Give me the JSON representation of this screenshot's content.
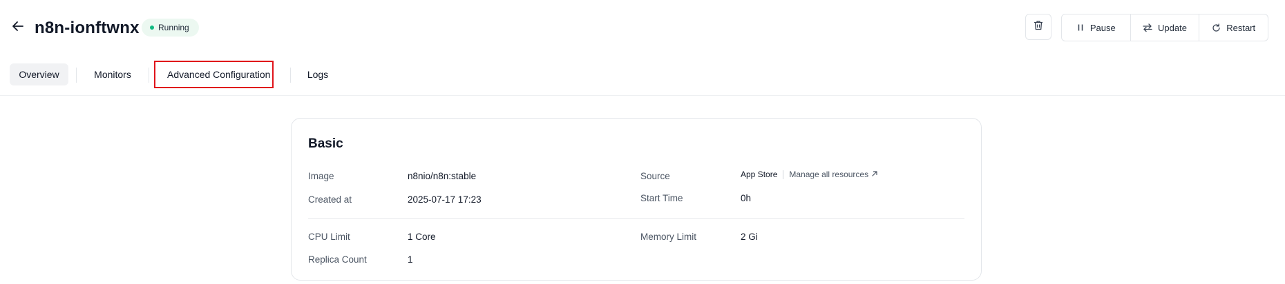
{
  "header": {
    "title": "n8n-ionftwnx",
    "status": "Running",
    "status_color": "#10b981",
    "back_icon": "arrow-left-icon",
    "delete_icon": "trash-icon",
    "actions": [
      {
        "label": "Pause",
        "icon": "pause-icon"
      },
      {
        "label": "Update",
        "icon": "swap-arrows-icon"
      },
      {
        "label": "Restart",
        "icon": "restart-icon"
      }
    ]
  },
  "tabs": [
    {
      "label": "Overview",
      "active": true
    },
    {
      "label": "Monitors",
      "active": false
    },
    {
      "label": "Advanced Configuration",
      "active": false,
      "highlighted": true
    },
    {
      "label": "Logs",
      "active": false
    }
  ],
  "highlight_color": "#e0131a",
  "basic": {
    "title": "Basic",
    "image_label": "Image",
    "image_value": "n8nio/n8n:stable",
    "created_label": "Created at",
    "created_value": "2025-07-17 17:23",
    "source_label": "Source",
    "source_value": "App Store",
    "manage_link": "Manage all resources",
    "start_time_label": "Start Time",
    "start_time_value": "0h",
    "cpu_label": "CPU Limit",
    "cpu_value": "1 Core",
    "memory_label": "Memory Limit",
    "memory_value": "2 Gi",
    "replica_label": "Replica Count",
    "replica_value": "1"
  }
}
